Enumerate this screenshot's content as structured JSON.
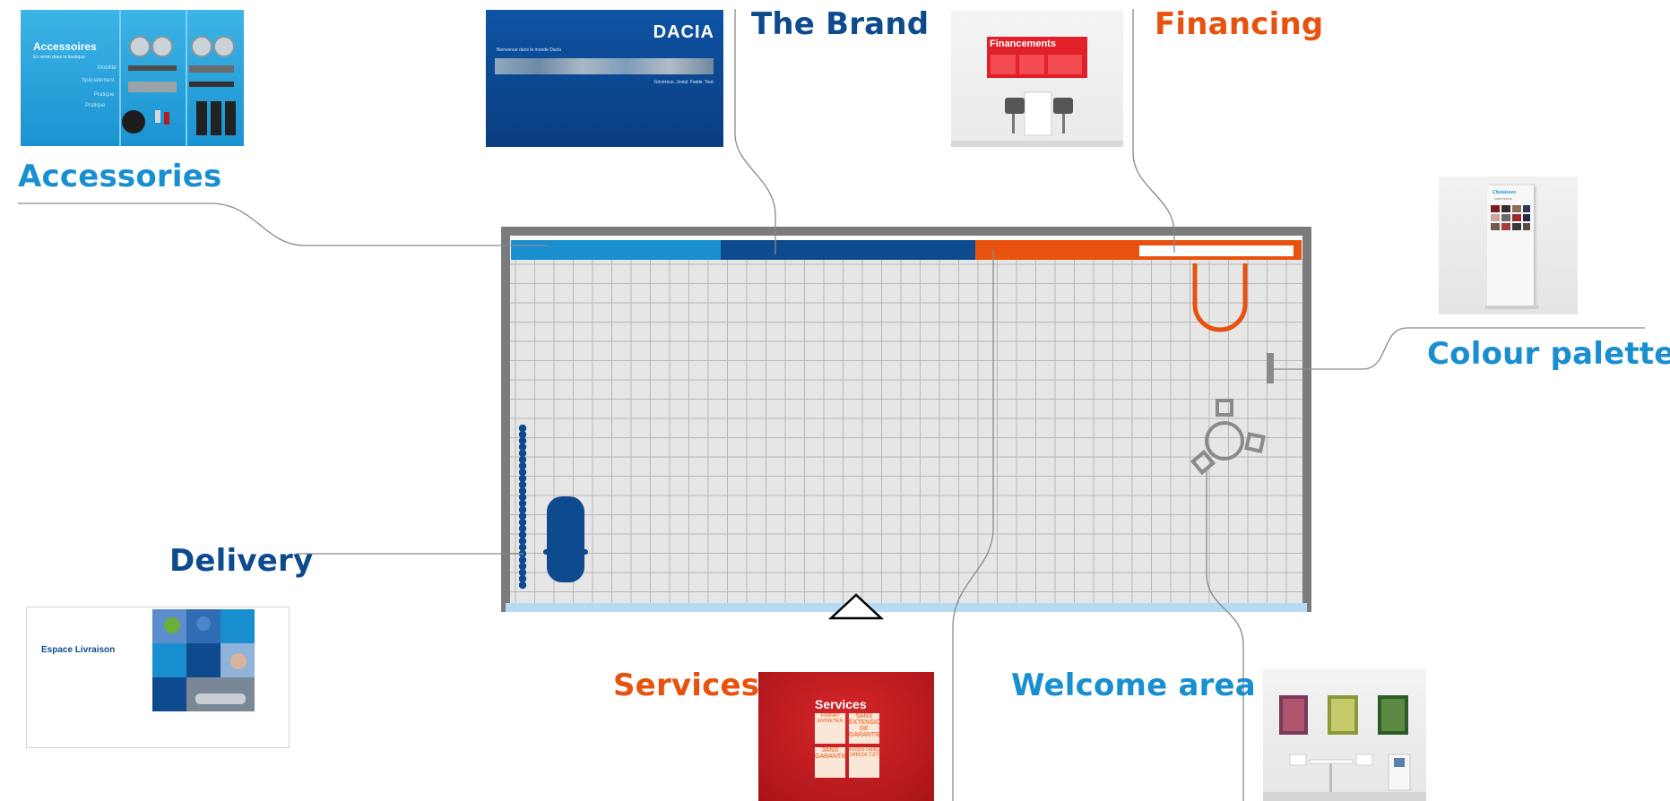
{
  "colors": {
    "accessories_blue": "#1a8fd0",
    "brand_blue": "#0d4a8e",
    "financing_orange": "#e8520f",
    "services_red": "#c11a1d",
    "wall_grey": "#7b7b7b",
    "floor": "#e6e6e6",
    "grid": "#b8b8b8",
    "entrance": "#b7dbf3"
  },
  "zones": {
    "accessories": "Accessories",
    "brand": "The Brand",
    "financing": "Financing",
    "colour_palette": "Colour palette",
    "delivery": "Delivery",
    "services": "Services",
    "welcome": "Welcome area"
  },
  "thumbs": {
    "accessories": {
      "title": "Accessoires",
      "subtitle": "En vente dans la boutique",
      "lines": [
        "Mobilité",
        "Spécialement",
        "Pratique",
        "Pratique"
      ]
    },
    "brand": {
      "logo": "DACIA",
      "line1": "Bienvenue dans le monde Dacia",
      "line2": "Généreux. Jovial. Fiable. Tout."
    },
    "financing": {
      "title": "Financements"
    },
    "colour": {
      "title": "Choisissez",
      "subtitle": "votre teinte"
    },
    "delivery": {
      "title": "Espace Livraison"
    },
    "services": {
      "title": "Services",
      "cards": [
        "FORFAIT ENTRETIEN",
        "5ANS EXTENSION DE GARANTIE",
        "3ANS GARANTIE",
        "ASSISTANCE 24H/24 7J/7"
      ]
    }
  }
}
